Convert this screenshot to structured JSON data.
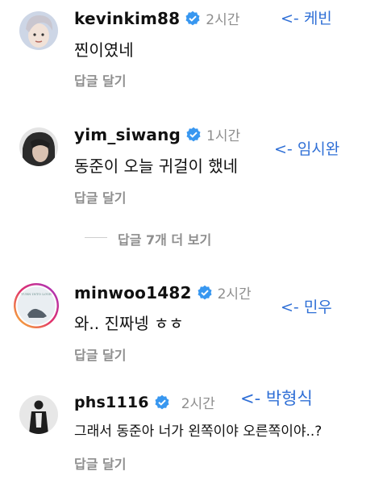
{
  "comments": [
    {
      "username": "kevinkim88",
      "time": "2시간",
      "text": "찐이였네",
      "reply": "답글 달기",
      "annotation": "<- 케빈"
    },
    {
      "username": "yim_siwang",
      "time": "1시간",
      "text": "동준이 오늘 귀걸이 했네",
      "reply": "답글 달기",
      "annotation": "<- 임시완"
    },
    {
      "username": "minwoo1482",
      "time": "2시간",
      "text": "와.. 진짜넹 ㅎㅎ",
      "reply": "답글 달기",
      "annotation": "<- 민우",
      "avatar_text": "TURN INTO LOVE"
    },
    {
      "username": "phs1116",
      "time": "2시간",
      "text": "그래서 동준아 너가 왼쪽이야 오른쪽이야..?",
      "reply": "답글 달기",
      "annotation": "<- 박형식"
    }
  ],
  "more_replies": "답글 7개 더 보기",
  "colors": {
    "verified": "#3897f0",
    "annotation": "#2f6fd6",
    "muted": "#8e8e8e"
  }
}
